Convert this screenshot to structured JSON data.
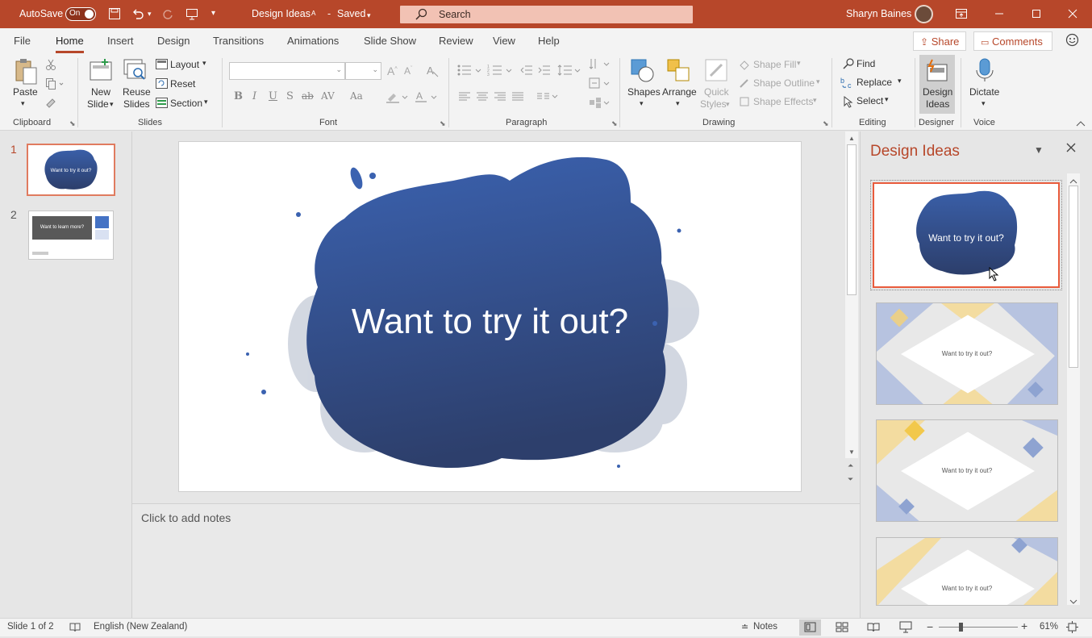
{
  "titlebar": {
    "autosave_label": "AutoSave",
    "toggle_state": "On",
    "doc_title": "Design Ideas",
    "save_status": "Saved",
    "search_placeholder": "Search",
    "user_name": "Sharyn Baines"
  },
  "tabs": [
    "File",
    "Home",
    "Insert",
    "Design",
    "Transitions",
    "Animations",
    "Slide Show",
    "Review",
    "View",
    "Help"
  ],
  "active_tab": "Home",
  "share_label": "Share",
  "comments_label": "Comments",
  "ribbon": {
    "clipboard": {
      "paste": "Paste",
      "group": "Clipboard"
    },
    "slides": {
      "new_slide_1": "New",
      "new_slide_2": "Slide",
      "reuse_1": "Reuse",
      "reuse_2": "Slides",
      "layout": "Layout",
      "reset": "Reset",
      "section": "Section",
      "group": "Slides"
    },
    "font": {
      "group": "Font",
      "bold": "B",
      "italic": "I",
      "underline": "U",
      "shadow": "S",
      "strike": "ab",
      "spacing": "AV",
      "case": "Aa"
    },
    "paragraph": {
      "group": "Paragraph"
    },
    "drawing": {
      "shapes": "Shapes",
      "arrange": "Arrange",
      "quick_1": "Quick",
      "quick_2": "Styles",
      "shape_fill": "Shape Fill",
      "shape_outline": "Shape Outline",
      "shape_effects": "Shape Effects",
      "group": "Drawing"
    },
    "editing": {
      "find": "Find",
      "replace": "Replace",
      "select": "Select",
      "group": "Editing"
    },
    "designer": {
      "label_1": "Design",
      "label_2": "Ideas",
      "group": "Designer"
    },
    "voice": {
      "label": "Dictate",
      "group": "Voice"
    }
  },
  "thumbnails": [
    {
      "num": "1",
      "text": "Want to try it out?"
    },
    {
      "num": "2",
      "text": "Want to learn more?"
    }
  ],
  "slide": {
    "title": "Want to try it out?"
  },
  "notes_placeholder": "Click to add notes",
  "design_pane": {
    "title": "Design Ideas",
    "ideas": [
      {
        "text": "Want to try it out?"
      },
      {
        "text": "Want to try it out?"
      },
      {
        "text": "Want to try it out?"
      },
      {
        "text": "Want to try it out?"
      }
    ]
  },
  "status": {
    "slide_info": "Slide 1 of 2",
    "language": "English (New Zealand)",
    "notes": "Notes",
    "zoom": "61%"
  },
  "colors": {
    "accent": "#b7472a",
    "blob_top": "#3a5fa8",
    "blob_bottom": "#2c3e6b"
  }
}
